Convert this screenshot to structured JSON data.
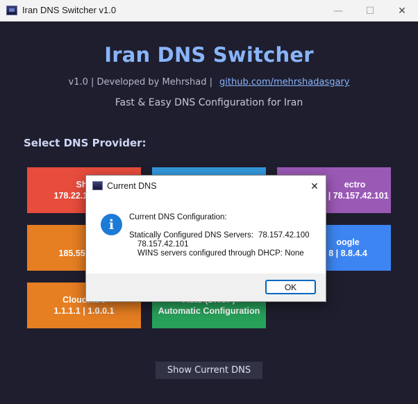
{
  "window": {
    "title": "Iran DNS Switcher v1.0",
    "minimize_glyph": "—",
    "maximize_glyph": "☐",
    "close_glyph": "✕",
    "icon": "app-icon"
  },
  "header": {
    "title": "Iran DNS Switcher",
    "credits": "v1.0 | Developed by Mehrshad |",
    "github_link": "github.com/mehrshadasgary",
    "tagline": "Fast & Easy DNS Configuration for Iran"
  },
  "providers": {
    "section_label": "Select DNS Provider:",
    "items": [
      {
        "name": "She",
        "servers": "178.22.122.100",
        "color": "#e74c3c"
      },
      {
        "name": "",
        "servers": "",
        "color": "#3498db"
      },
      {
        "name": "ectro",
        "servers": "0 | 78.157.42.101",
        "color": "#9b59b6"
      },
      {
        "name": "Beg",
        "servers": "185.55.226.26 |",
        "color": "#e67e22"
      },
      {
        "name": "oogle",
        "servers": "8 | 8.8.4.4",
        "color": "#3d85f2"
      },
      {
        "name": "Cloudflare",
        "servers": "1.1.1.1 | 1.0.0.1",
        "color": "#e67e22"
      },
      {
        "name": "Auto (DHCP)",
        "servers": "Automatic Configuration",
        "color": "#27a15a"
      }
    ]
  },
  "footer": {
    "show_button": "Show Current DNS"
  },
  "dialog": {
    "title": "Current DNS",
    "close_glyph": "✕",
    "icon": "info-icon",
    "info_glyph": "i",
    "heading": "Current DNS Configuration:",
    "static_label": "Statically Configured DNS Servers:",
    "static_primary": "78.157.42.100",
    "static_secondary": "78.157.42.101",
    "wins_line": "WINS servers configured through DHCP: None",
    "ok_label": "OK"
  }
}
